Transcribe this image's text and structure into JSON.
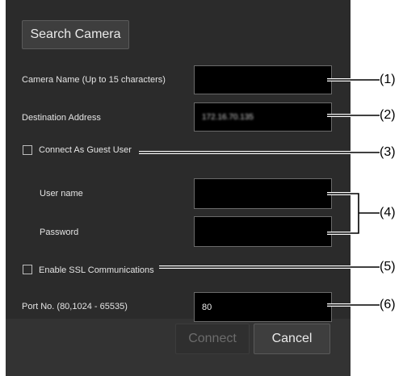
{
  "dialog": {
    "search_button": "Search Camera",
    "camera_name_label": "Camera Name  (Up to 15 characters)",
    "camera_name_value": "",
    "destination_label": "Destination Address",
    "destination_value": "172.16.70.135",
    "guest_label": "Connect As Guest User",
    "guest_checked": false,
    "username_label": "User name",
    "username_value": "",
    "password_label": "Password",
    "password_value": "",
    "ssl_label": "Enable SSL Communications",
    "ssl_checked": false,
    "port_label": "Port No. (80,1024 - 65535)",
    "port_value": "80",
    "connect_button": "Connect",
    "cancel_button": "Cancel"
  },
  "callouts": [
    "(1)",
    "(2)",
    "(3)",
    "(4)",
    "(5)",
    "(6)"
  ],
  "colors": {
    "panel_bg": "#2b2b2b",
    "field_bg": "#000000",
    "button_bg": "#3e3e3e",
    "text": "#e4e4e4",
    "disabled_text": "#6c6c6c"
  }
}
